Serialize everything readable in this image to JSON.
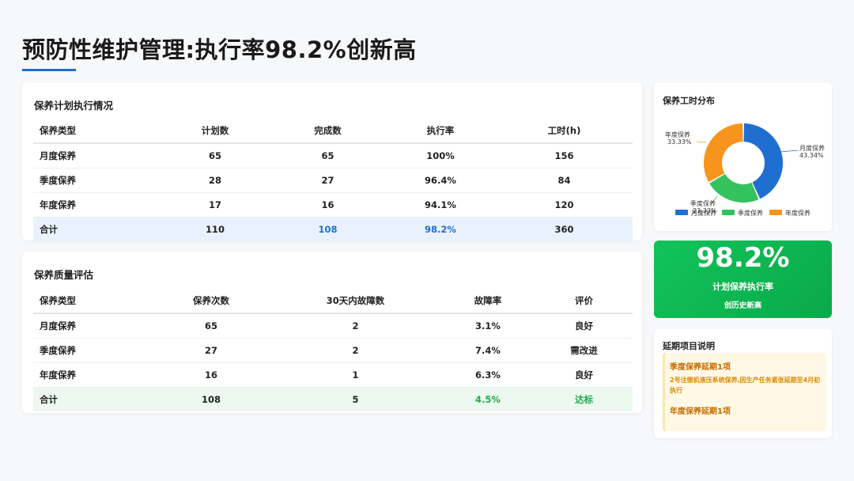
{
  "page": {
    "title": "预防性维护管理:执行率98.2%创新高"
  },
  "plan_table": {
    "title": "保养计划执行情况",
    "headers": [
      "保养类型",
      "计划数",
      "完成数",
      "执行率",
      "工时(h)"
    ],
    "rows": [
      [
        "月度保养",
        "65",
        "65",
        "100%",
        "156"
      ],
      [
        "季度保养",
        "28",
        "27",
        "96.4%",
        "84"
      ],
      [
        "年度保养",
        "17",
        "16",
        "94.1%",
        "120"
      ]
    ],
    "total": [
      "合计",
      "110",
      "108",
      "98.2%",
      "360"
    ]
  },
  "quality_table": {
    "title": "保养质量评估",
    "headers": [
      "保养类型",
      "保养次数",
      "30天内故障数",
      "故障率",
      "评价"
    ],
    "rows": [
      [
        "月度保养",
        "65",
        "2",
        "3.1%",
        "良好"
      ],
      [
        "季度保养",
        "27",
        "2",
        "7.4%",
        "需改进"
      ],
      [
        "年度保养",
        "16",
        "1",
        "6.3%",
        "良好"
      ]
    ],
    "total": [
      "合计",
      "108",
      "5",
      "4.5%",
      "达标"
    ]
  },
  "hours_chart": {
    "title": "保养工时分布",
    "labels": {
      "monthly_name": "月度保养",
      "monthly_pct": "43.34%",
      "quarterly_name": "季度保养",
      "quarterly_pct": "23.33%",
      "yearly_name": "年度保养",
      "yearly_pct": "33.33%"
    },
    "legend": [
      "月度保养",
      "季度保养",
      "年度保养"
    ]
  },
  "chart_data": {
    "type": "pie",
    "title": "保养工时分布",
    "categories": [
      "月度保养",
      "季度保养",
      "年度保养"
    ],
    "values": [
      43.34,
      23.33,
      33.33
    ],
    "colors": [
      "#1f6fd1",
      "#34c25c",
      "#f7941d"
    ],
    "donut": true,
    "legend": "bottom"
  },
  "kpi": {
    "value": "98.2%",
    "label": "计划保养执行率",
    "sub": "创历史新高"
  },
  "delay_notes": {
    "title": "延期项目说明",
    "items": [
      {
        "head": "季度保养延期1项",
        "body": "2号注塑机液压系统保养,因生产任务紧张延期至4月初执行"
      },
      {
        "head": "年度保养延期1项",
        "body": ""
      }
    ]
  }
}
